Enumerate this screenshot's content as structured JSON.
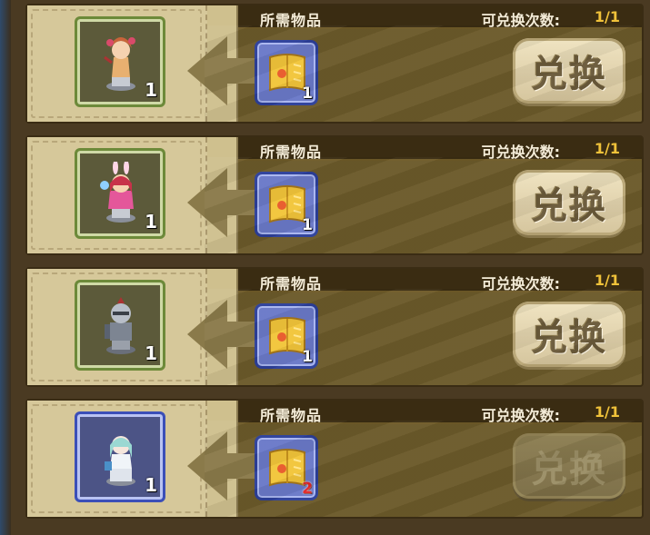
{
  "labels": {
    "required_items": "所需物品",
    "exchange_count_label": "可兑换次数:",
    "exchange_button": "兑换"
  },
  "rows": [
    {
      "reward": {
        "name": "robot-girl-figure",
        "qty": "1",
        "frame": "green"
      },
      "cost": {
        "icon": "golden-scroll",
        "qty": "1"
      },
      "remaining": "1/1",
      "enabled": true
    },
    {
      "reward": {
        "name": "bunny-girl-figure",
        "qty": "1",
        "frame": "green"
      },
      "cost": {
        "icon": "golden-scroll",
        "qty": "1"
      },
      "remaining": "1/1",
      "enabled": true
    },
    {
      "reward": {
        "name": "knight-figure",
        "qty": "1",
        "frame": "green"
      },
      "cost": {
        "icon": "golden-scroll",
        "qty": "1"
      },
      "remaining": "1/1",
      "enabled": true
    },
    {
      "reward": {
        "name": "maid-bot-figure",
        "qty": "1",
        "frame": "blue"
      },
      "cost": {
        "icon": "golden-scroll",
        "qty": "2",
        "insufficient": true
      },
      "remaining": "1/1",
      "enabled": false
    }
  ],
  "colors": {
    "count_value": "#f0c23a",
    "insufficient_qty": "#e02828",
    "green_frame": "#6d8a3a",
    "blue_frame": "#3b4fb8"
  }
}
